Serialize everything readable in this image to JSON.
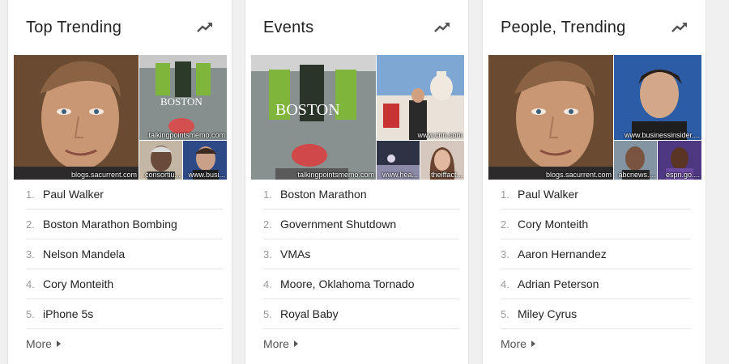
{
  "cards": [
    {
      "title": "Top Trending",
      "icon": "trending-up-icon",
      "images": [
        {
          "subject": "face-portrait",
          "source": "blogs.sacurrent.com"
        },
        {
          "subject": "magazine-cover",
          "source": "talkingpointsmemo.com"
        },
        {
          "subject": "face-portrait",
          "source": "consortiu..."
        },
        {
          "subject": "face-portrait",
          "source": "www.busi..."
        }
      ],
      "items": [
        {
          "num": "1.",
          "label": "Paul Walker"
        },
        {
          "num": "2.",
          "label": "Boston Marathon Bombing"
        },
        {
          "num": "3.",
          "label": "Nelson Mandela"
        },
        {
          "num": "4.",
          "label": "Cory Monteith"
        },
        {
          "num": "5.",
          "label": "iPhone 5s"
        }
      ],
      "more_label": "More"
    },
    {
      "title": "Events",
      "icon": "trending-up-icon",
      "images": [
        {
          "subject": "magazine-cover",
          "source": "talkingpointsmemo.com"
        },
        {
          "subject": "capitol-building",
          "source": "www.cnn.com"
        },
        {
          "subject": "stage-scene",
          "source": "www.hea..."
        },
        {
          "subject": "face-portrait",
          "source": "theiffact..."
        }
      ],
      "items": [
        {
          "num": "1.",
          "label": "Boston Marathon"
        },
        {
          "num": "2.",
          "label": "Government Shutdown"
        },
        {
          "num": "3.",
          "label": "VMAs"
        },
        {
          "num": "4.",
          "label": "Moore, Oklahoma Tornado"
        },
        {
          "num": "5.",
          "label": "Royal Baby"
        }
      ],
      "more_label": "More"
    },
    {
      "title": "People, Trending",
      "icon": "trending-up-icon",
      "images": [
        {
          "subject": "face-portrait",
          "source": "blogs.sacurrent.com"
        },
        {
          "subject": "face-portrait",
          "source": "www.businessinsider...."
        },
        {
          "subject": "face-portrait",
          "source": "abcnews...."
        },
        {
          "subject": "face-portrait",
          "source": "espn.go...."
        }
      ],
      "items": [
        {
          "num": "1.",
          "label": "Paul Walker"
        },
        {
          "num": "2.",
          "label": "Cory Monteith"
        },
        {
          "num": "3.",
          "label": "Aaron Hernandez"
        },
        {
          "num": "4.",
          "label": "Adrian Peterson"
        },
        {
          "num": "5.",
          "label": "Miley Cyrus"
        }
      ],
      "more_label": "More"
    }
  ],
  "colors": {
    "background": "#f0f0f0",
    "card": "#ffffff",
    "text": "#222222",
    "muted": "#999999",
    "divider": "#e4e4e4"
  }
}
